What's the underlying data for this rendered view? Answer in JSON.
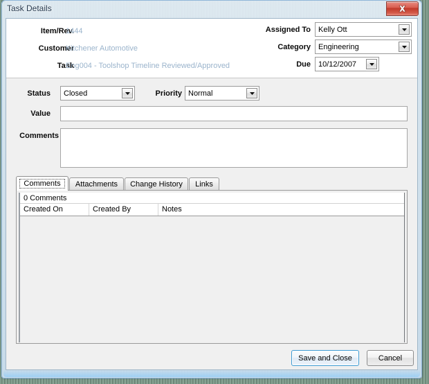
{
  "window": {
    "title": "Task Details",
    "close_label": "Close",
    "close_glyph": "x"
  },
  "header": {
    "fields": [
      {
        "label": "Item/Rev.",
        "value": "1444"
      },
      {
        "label": "Customer",
        "value": "Kitchener Automotive"
      },
      {
        "label": "Task",
        "value": "Eng004 - Toolshop Timeline Reviewed/Approved"
      }
    ],
    "right_fields": [
      {
        "label": "Assigned To",
        "value": "Kelly Ott"
      },
      {
        "label": "Category",
        "value": "Engineering"
      },
      {
        "label": "Due",
        "value": "10/12/2007"
      }
    ]
  },
  "form": {
    "status_label": "Status",
    "status_value": "Closed",
    "priority_label": "Priority",
    "priority_value": "Normal",
    "value_label": "Value",
    "value_text": "",
    "comments_label": "Comments",
    "comments_text": ""
  },
  "tabs": [
    {
      "label": "Comments",
      "active": true
    },
    {
      "label": "Attachments",
      "active": false
    },
    {
      "label": "Change History",
      "active": false
    },
    {
      "label": "Links",
      "active": false
    }
  ],
  "grid": {
    "caption": "0 Comments",
    "columns": [
      "Created On",
      "Created By",
      "Notes"
    ],
    "rows": []
  },
  "footer": {
    "save_label": "Save and Close",
    "cancel_label": "Cancel"
  },
  "colors": {
    "titlebar_text": "#23374d",
    "readonly_value": "#9bb4cc",
    "close_button": "#c0392a",
    "default_button_border": "#3c9ad3"
  }
}
